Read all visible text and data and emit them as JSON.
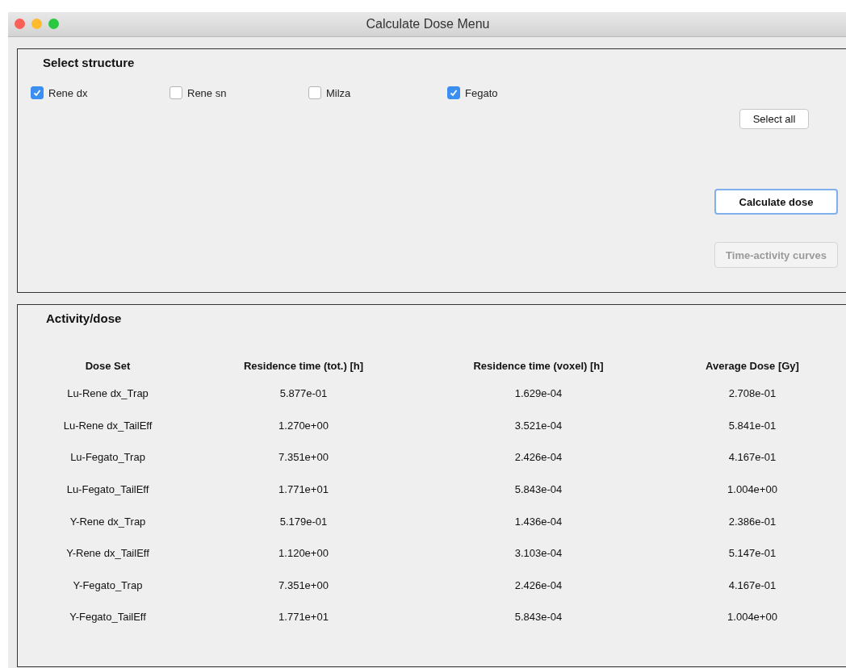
{
  "window": {
    "title": "Calculate Dose Menu"
  },
  "structure_panel": {
    "title": "Select structure",
    "checkboxes": [
      {
        "label": "Rene dx",
        "checked": true
      },
      {
        "label": "Rene sn",
        "checked": false
      },
      {
        "label": "Milza",
        "checked": false
      },
      {
        "label": "Fegato",
        "checked": true
      }
    ],
    "buttons": [
      {
        "label": "Select all",
        "kind": "normal",
        "disabled": false
      },
      {
        "label": "Calculate dose",
        "kind": "default",
        "disabled": false
      },
      {
        "label": "Time-activity curves",
        "kind": "normal",
        "disabled": true
      }
    ]
  },
  "dose_panel": {
    "title": "Activity/dose",
    "table": {
      "columns": [
        "Dose Set",
        "Residence time (tot.) [h]",
        "Residence time (voxel) [h]",
        "Average Dose [Gy]"
      ],
      "rows": [
        [
          "Lu-Rene dx_Trap",
          "5.877e-01",
          "1.629e-04",
          "2.708e-01"
        ],
        [
          "Lu-Rene dx_TailEff",
          "1.270e+00",
          "3.521e-04",
          "5.841e-01"
        ],
        [
          "Lu-Fegato_Trap",
          "7.351e+00",
          "2.426e-04",
          "4.167e-01"
        ],
        [
          "Lu-Fegato_TailEff",
          "1.771e+01",
          "5.843e-04",
          "1.004e+00"
        ],
        [
          "Y-Rene dx_Trap",
          "5.179e-01",
          "1.436e-04",
          "2.386e-01"
        ],
        [
          "Y-Rene dx_TailEff",
          "1.120e+00",
          "3.103e-04",
          "5.147e-01"
        ],
        [
          "Y-Fegato_Trap",
          "7.351e+00",
          "2.426e-04",
          "4.167e-01"
        ],
        [
          "Y-Fegato_TailEff",
          "1.771e+01",
          "5.843e-04",
          "1.004e+00"
        ]
      ]
    }
  }
}
